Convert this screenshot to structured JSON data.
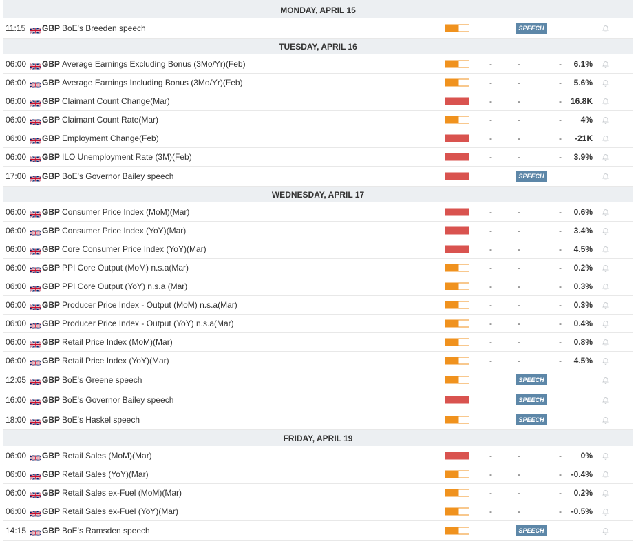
{
  "calendar": {
    "days": [
      {
        "date": "MONDAY, APRIL 15",
        "events": [
          {
            "time": "11:15",
            "currency": "GBP",
            "name": "BoE's Breeden speech",
            "impact": "medium",
            "badge": "SPEECH"
          }
        ]
      },
      {
        "date": "TUESDAY, APRIL 16",
        "events": [
          {
            "time": "06:00",
            "currency": "GBP",
            "name": "Average Earnings Excluding Bonus (3Mo/Yr)(Feb)",
            "impact": "medium",
            "actual": "-",
            "deviation": "-",
            "consensus": "-",
            "previous": "6.1%"
          },
          {
            "time": "06:00",
            "currency": "GBP",
            "name": "Average Earnings Including Bonus (3Mo/Yr)(Feb)",
            "impact": "medium",
            "actual": "-",
            "deviation": "-",
            "consensus": "-",
            "previous": "5.6%"
          },
          {
            "time": "06:00",
            "currency": "GBP",
            "name": "Claimant Count Change(Mar)",
            "impact": "high",
            "actual": "-",
            "deviation": "-",
            "consensus": "-",
            "previous": "16.8K"
          },
          {
            "time": "06:00",
            "currency": "GBP",
            "name": "Claimant Count Rate(Mar)",
            "impact": "medium",
            "actual": "-",
            "deviation": "-",
            "consensus": "-",
            "previous": "4%"
          },
          {
            "time": "06:00",
            "currency": "GBP",
            "name": "Employment Change(Feb)",
            "impact": "high",
            "actual": "-",
            "deviation": "-",
            "consensus": "-",
            "previous": "-21K"
          },
          {
            "time": "06:00",
            "currency": "GBP",
            "name": "ILO Unemployment Rate (3M)(Feb)",
            "impact": "high",
            "actual": "-",
            "deviation": "-",
            "consensus": "-",
            "previous": "3.9%"
          },
          {
            "time": "17:00",
            "currency": "GBP",
            "name": "BoE's Governor Bailey speech",
            "impact": "high",
            "badge": "SPEECH"
          }
        ]
      },
      {
        "date": "WEDNESDAY, APRIL 17",
        "events": [
          {
            "time": "06:00",
            "currency": "GBP",
            "name": "Consumer Price Index (MoM)(Mar)",
            "impact": "high",
            "actual": "-",
            "deviation": "-",
            "consensus": "-",
            "previous": "0.6%"
          },
          {
            "time": "06:00",
            "currency": "GBP",
            "name": "Consumer Price Index (YoY)(Mar)",
            "impact": "high",
            "actual": "-",
            "deviation": "-",
            "consensus": "-",
            "previous": "3.4%"
          },
          {
            "time": "06:00",
            "currency": "GBP",
            "name": "Core Consumer Price Index (YoY)(Mar)",
            "impact": "high",
            "actual": "-",
            "deviation": "-",
            "consensus": "-",
            "previous": "4.5%"
          },
          {
            "time": "06:00",
            "currency": "GBP",
            "name": "PPI Core Output (MoM) n.s.a(Mar)",
            "impact": "medium",
            "actual": "-",
            "deviation": "-",
            "consensus": "-",
            "previous": "0.2%"
          },
          {
            "time": "06:00",
            "currency": "GBP",
            "name": "PPI Core Output (YoY) n.s.a (Mar)",
            "impact": "medium",
            "actual": "-",
            "deviation": "-",
            "consensus": "-",
            "previous": "0.3%"
          },
          {
            "time": "06:00",
            "currency": "GBP",
            "name": "Producer Price Index - Output (MoM) n.s.a(Mar)",
            "impact": "medium",
            "actual": "-",
            "deviation": "-",
            "consensus": "-",
            "previous": "0.3%"
          },
          {
            "time": "06:00",
            "currency": "GBP",
            "name": "Producer Price Index - Output (YoY) n.s.a(Mar)",
            "impact": "medium",
            "actual": "-",
            "deviation": "-",
            "consensus": "-",
            "previous": "0.4%"
          },
          {
            "time": "06:00",
            "currency": "GBP",
            "name": "Retail Price Index (MoM)(Mar)",
            "impact": "medium",
            "actual": "-",
            "deviation": "-",
            "consensus": "-",
            "previous": "0.8%"
          },
          {
            "time": "06:00",
            "currency": "GBP",
            "name": "Retail Price Index (YoY)(Mar)",
            "impact": "medium",
            "actual": "-",
            "deviation": "-",
            "consensus": "-",
            "previous": "4.5%"
          },
          {
            "time": "12:05",
            "currency": "GBP",
            "name": "BoE's Greene speech",
            "impact": "medium",
            "badge": "SPEECH"
          },
          {
            "time": "16:00",
            "currency": "GBP",
            "name": "BoE's Governor Bailey speech",
            "impact": "high",
            "badge": "SPEECH"
          },
          {
            "time": "18:00",
            "currency": "GBP",
            "name": "BoE's Haskel speech",
            "impact": "medium",
            "badge": "SPEECH"
          }
        ]
      },
      {
        "date": "FRIDAY, APRIL 19",
        "events": [
          {
            "time": "06:00",
            "currency": "GBP",
            "name": "Retail Sales (MoM)(Mar)",
            "impact": "high",
            "actual": "-",
            "deviation": "-",
            "consensus": "-",
            "previous": "0%"
          },
          {
            "time": "06:00",
            "currency": "GBP",
            "name": "Retail Sales (YoY)(Mar)",
            "impact": "medium",
            "actual": "-",
            "deviation": "-",
            "consensus": "-",
            "previous": "-0.4%"
          },
          {
            "time": "06:00",
            "currency": "GBP",
            "name": "Retail Sales ex-Fuel (MoM)(Mar)",
            "impact": "medium",
            "actual": "-",
            "deviation": "-",
            "consensus": "-",
            "previous": "0.2%"
          },
          {
            "time": "06:00",
            "currency": "GBP",
            "name": "Retail Sales ex-Fuel (YoY)(Mar)",
            "impact": "medium",
            "actual": "-",
            "deviation": "-",
            "consensus": "-",
            "previous": "-0.5%"
          },
          {
            "time": "14:15",
            "currency": "GBP",
            "name": "BoE's Ramsden speech",
            "impact": "medium",
            "badge": "SPEECH"
          }
        ]
      }
    ]
  },
  "colors": {
    "impact_high": "#d9534f",
    "impact_medium": "#f0921e",
    "speech_badge": "#5d87a8",
    "day_header_bg": "#eceff2"
  },
  "icons": {
    "flag": "uk-flag-icon",
    "alert": "bell-icon"
  }
}
